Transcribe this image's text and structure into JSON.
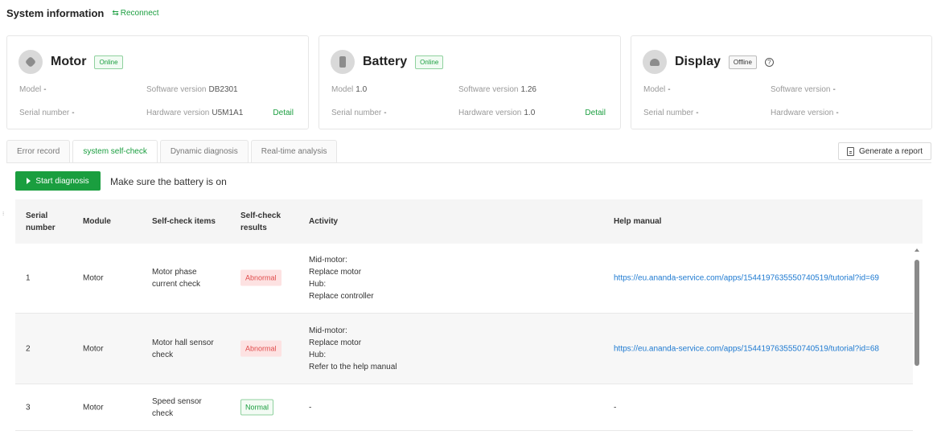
{
  "header": {
    "title": "System information",
    "reconnect": "Reconnect"
  },
  "cards": {
    "motor": {
      "name": "Motor",
      "status": "Online",
      "model_label": "Model",
      "model_value": "-",
      "sw_label": "Software version",
      "sw_value": "DB2301",
      "serial_label": "Serial number",
      "serial_value": "-",
      "hw_label": "Hardware version",
      "hw_value": "U5M1A1",
      "detail": "Detail"
    },
    "battery": {
      "name": "Battery",
      "status": "Online",
      "model_label": "Model",
      "model_value": "1.0",
      "sw_label": "Software version",
      "sw_value": "1.26",
      "serial_label": "Serial number",
      "serial_value": "-",
      "hw_label": "Hardware version",
      "hw_value": "1.0",
      "detail": "Detail"
    },
    "display": {
      "name": "Display",
      "status": "Offline",
      "model_label": "Model",
      "model_value": "-",
      "sw_label": "Software version",
      "sw_value": "-",
      "serial_label": "Serial number",
      "serial_value": "-",
      "hw_label": "Hardware version",
      "hw_value": "-"
    }
  },
  "tabs": [
    "Error record",
    "system self-check",
    "Dynamic diagnosis",
    "Real-time analysis"
  ],
  "report_button": "Generate a report",
  "start_button": "Start diagnosis",
  "hint": "Make sure the battery is on",
  "table": {
    "headers": {
      "serial": [
        "Serial",
        "number"
      ],
      "module": "Module",
      "items": "Self-check items",
      "results": [
        "Self-check",
        "results"
      ],
      "activity": "Activity",
      "help": "Help manual"
    },
    "rows": [
      {
        "serial": "1",
        "module": "Motor",
        "item": [
          "Motor phase",
          "current check"
        ],
        "result": "Abnormal",
        "activity": [
          "Mid-motor:",
          "Replace motor",
          "Hub:",
          "Replace controller"
        ],
        "help": "https://eu.ananda-service.com/apps/1544197635550740519/tutorial?id=69"
      },
      {
        "serial": "2",
        "module": "Motor",
        "item": [
          "Motor hall sensor",
          "check"
        ],
        "result": "Abnormal",
        "activity": [
          "Mid-motor:",
          "Replace motor",
          "Hub:",
          "Refer to the help manual"
        ],
        "help": "https://eu.ananda-service.com/apps/1544197635550740519/tutorial?id=68"
      },
      {
        "serial": "3",
        "module": "Motor",
        "item": [
          "Speed sensor",
          "check"
        ],
        "result": "Normal",
        "activity": [
          "-"
        ],
        "help": "-"
      }
    ]
  },
  "colors": {
    "accent": "#1a9e3f",
    "link": "#1e7ad1",
    "abnormal": "#e04b4b"
  }
}
